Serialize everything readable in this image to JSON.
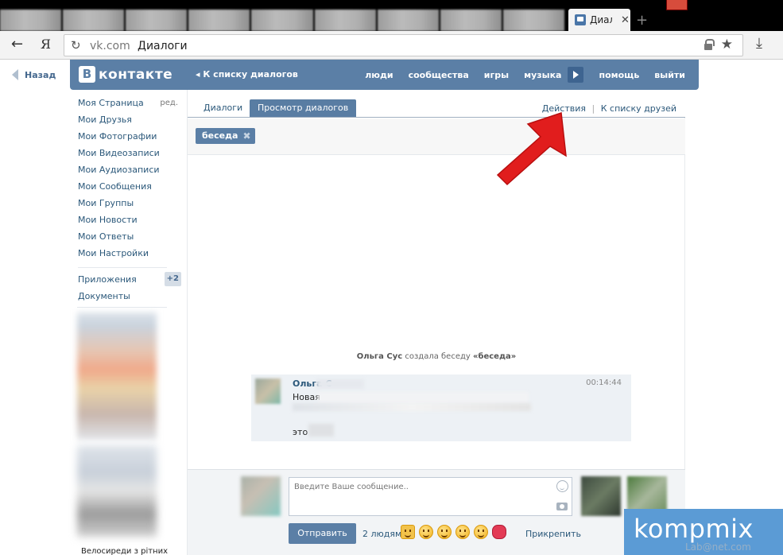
{
  "browser": {
    "tab_title": "Диало",
    "tab_close": "✕",
    "new_tab": "+",
    "toolbar": {
      "back": "←",
      "yandex": "Я",
      "reload": "↻",
      "domain": "vk.com",
      "page_title": "Диалоги",
      "star": "★",
      "download": "⤓"
    }
  },
  "vk": {
    "back_link": "Назад",
    "logo_letter": "В",
    "logo_text": "контакте",
    "head_back": "К списку диалогов",
    "nav": [
      "люди",
      "сообщества",
      "игры",
      "музыка",
      "помощь",
      "выйти"
    ],
    "left_menu": {
      "items": [
        "Моя Страница",
        "Мои Друзья",
        "Мои Фотографии",
        "Мои Видеозаписи",
        "Мои Аудиозаписи",
        "Мои Сообщения",
        "Мои Группы",
        "Мои Новости",
        "Мои Ответы",
        "Мои Настройки"
      ],
      "edit": "ред.",
      "apps": "Приложения",
      "apps_badge": "+2",
      "docs": "Документы",
      "caption": "Велосиреди з рітних"
    },
    "tabs": {
      "dialogs": "Диалоги",
      "view": "Просмотр диалогов",
      "actions": "Действия",
      "separator": "|",
      "to_friends": "К списку друзей"
    },
    "pill": {
      "label": "беседа",
      "close": "✖"
    },
    "system_message": {
      "author": "Ольга Сус",
      "text": "создала беседу",
      "chat": "«беседа»"
    },
    "message": {
      "author": "Ольга С",
      "time": "00:14:44",
      "line1": "Новая",
      "line3": "это"
    },
    "composer": {
      "placeholder": "Введите Ваше сообщение..",
      "send": "Отправить",
      "to_people": "2 людям",
      "attach": "Прикрепить"
    }
  },
  "watermark": {
    "text": "kompmix",
    "faint": "Lab@net.com"
  },
  "colors": {
    "vk_blue": "#5b7fa6",
    "link": "#2b587a",
    "arrow": "#e11d1d",
    "watermark": "#5b9bd5"
  }
}
